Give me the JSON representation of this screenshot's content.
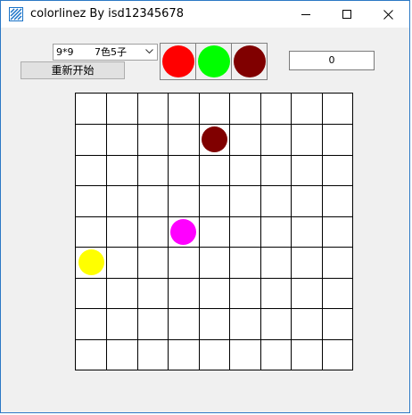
{
  "window": {
    "title": "colorlinez By isd12345678"
  },
  "controls": {
    "mode_select": {
      "size": "9*9",
      "config": "7色5子"
    },
    "restart_label": "重新开始",
    "score": "0"
  },
  "next_balls": [
    {
      "color": "#ff0000",
      "name": "red"
    },
    {
      "color": "#00ff00",
      "name": "green"
    },
    {
      "color": "#800000",
      "name": "dark-red"
    }
  ],
  "board": {
    "rows": 9,
    "cols": 9,
    "balls": [
      {
        "row": 1,
        "col": 4,
        "color": "#800000",
        "name": "dark-red"
      },
      {
        "row": 4,
        "col": 3,
        "color": "#ff00ff",
        "name": "magenta"
      },
      {
        "row": 5,
        "col": 0,
        "color": "#ffff00",
        "name": "yellow"
      }
    ]
  }
}
